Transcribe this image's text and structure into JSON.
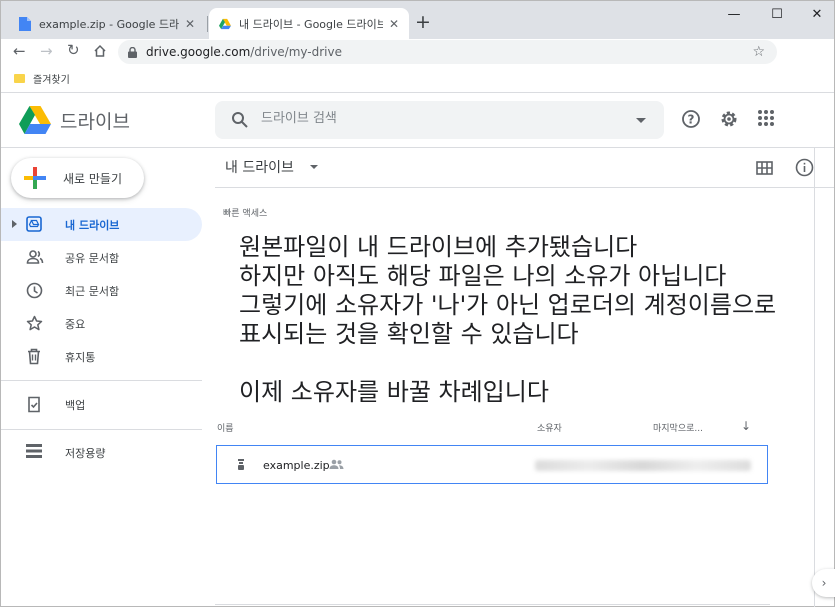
{
  "browser": {
    "tabs": [
      {
        "title": "example.zip - Google 드라이브",
        "active": false
      },
      {
        "title": "내 드라이브 - Google 드라이브",
        "active": true
      }
    ],
    "url_host": "drive.google.com",
    "url_path": "/drive/my-drive",
    "bookmark": "즐겨찾기",
    "window_controls": {
      "minimize": "—",
      "maximize": "☐",
      "close": "✕"
    }
  },
  "drive": {
    "app_title": "드라이브",
    "search_placeholder": "드라이브 검색",
    "new_button": "새로 만들기",
    "nav": [
      {
        "label": "내 드라이브",
        "icon": "my-drive-icon",
        "active": true
      },
      {
        "label": "공유 문서함",
        "icon": "shared-people-icon"
      },
      {
        "label": "최근 문서함",
        "icon": "clock-icon"
      },
      {
        "label": "중요",
        "icon": "star-icon"
      },
      {
        "label": "휴지통",
        "icon": "trash-icon"
      },
      {
        "label": "백업",
        "icon": "backup-icon"
      },
      {
        "label": "저장용량",
        "icon": "storage-icon"
      }
    ],
    "main_title": "내 드라이브",
    "quick_access": "빠른 액세스",
    "annotation_lines": [
      "원본파일이 내 드라이브에 추가됐습니다",
      "하지만 아직도 해당 파일은 나의 소유가 아닙니다",
      "그렇기에 소유자가 '나'가 아닌 업로더의 계정이름으로",
      "표시되는 것을 확인할 수 있습니다",
      "",
      "이제 소유자를 바꿀 차례입니다"
    ],
    "columns": {
      "name": "이름",
      "owner": "소유자",
      "modified": "마지막으로..."
    },
    "file": {
      "name": "example.zip",
      "shared": true
    },
    "accent_color": "#1967d2"
  }
}
